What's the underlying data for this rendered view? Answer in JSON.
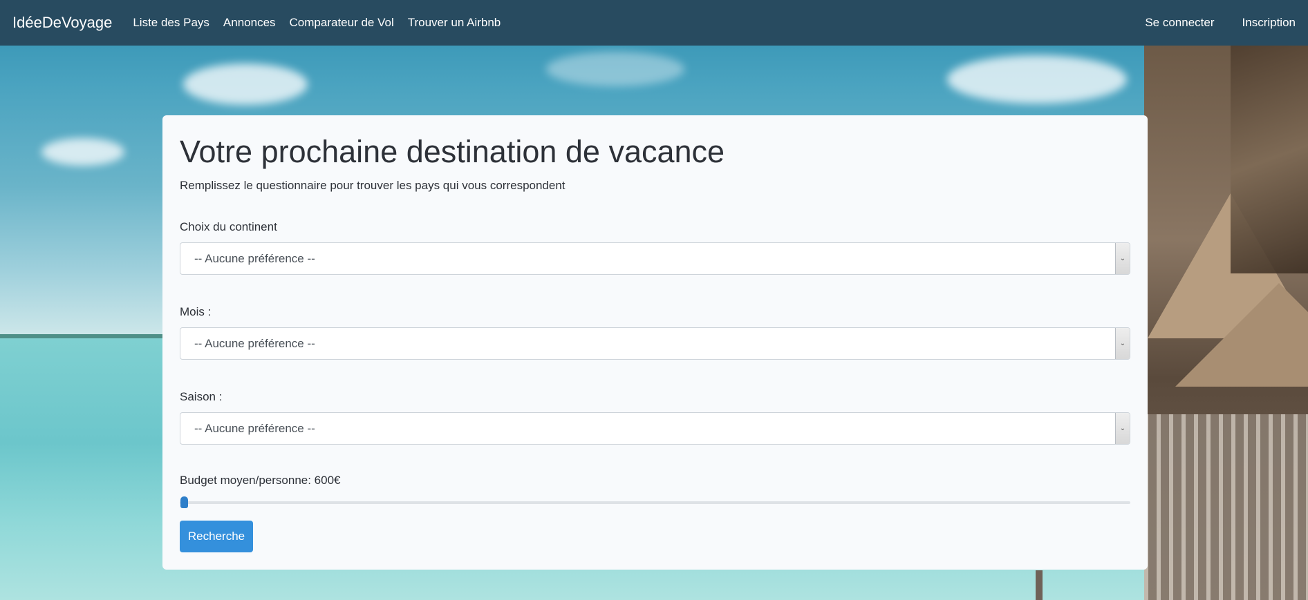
{
  "navbar": {
    "brand": "IdéeDeVoyage",
    "links": [
      "Liste des Pays",
      "Annonces",
      "Comparateur de Vol",
      "Trouver un Airbnb"
    ],
    "login": "Se connecter",
    "register": "Inscription"
  },
  "form": {
    "title": "Votre prochaine destination de vacance",
    "subtitle": "Remplissez le questionnaire pour trouver les pays qui vous correspondent",
    "continent": {
      "label": "Choix du continent",
      "value": "-- Aucune préférence --"
    },
    "month": {
      "label": "Mois :",
      "value": "-- Aucune préférence --"
    },
    "season": {
      "label": "Saison :",
      "value": "-- Aucune préférence --"
    },
    "budget": {
      "label": "Budget moyen/personne: 600€",
      "value": 600,
      "fraction": 0.0
    },
    "submit": "Recherche"
  },
  "colors": {
    "navbar": "#284b60",
    "button": "#3490dc",
    "slider_thumb": "#2d7ec9"
  }
}
